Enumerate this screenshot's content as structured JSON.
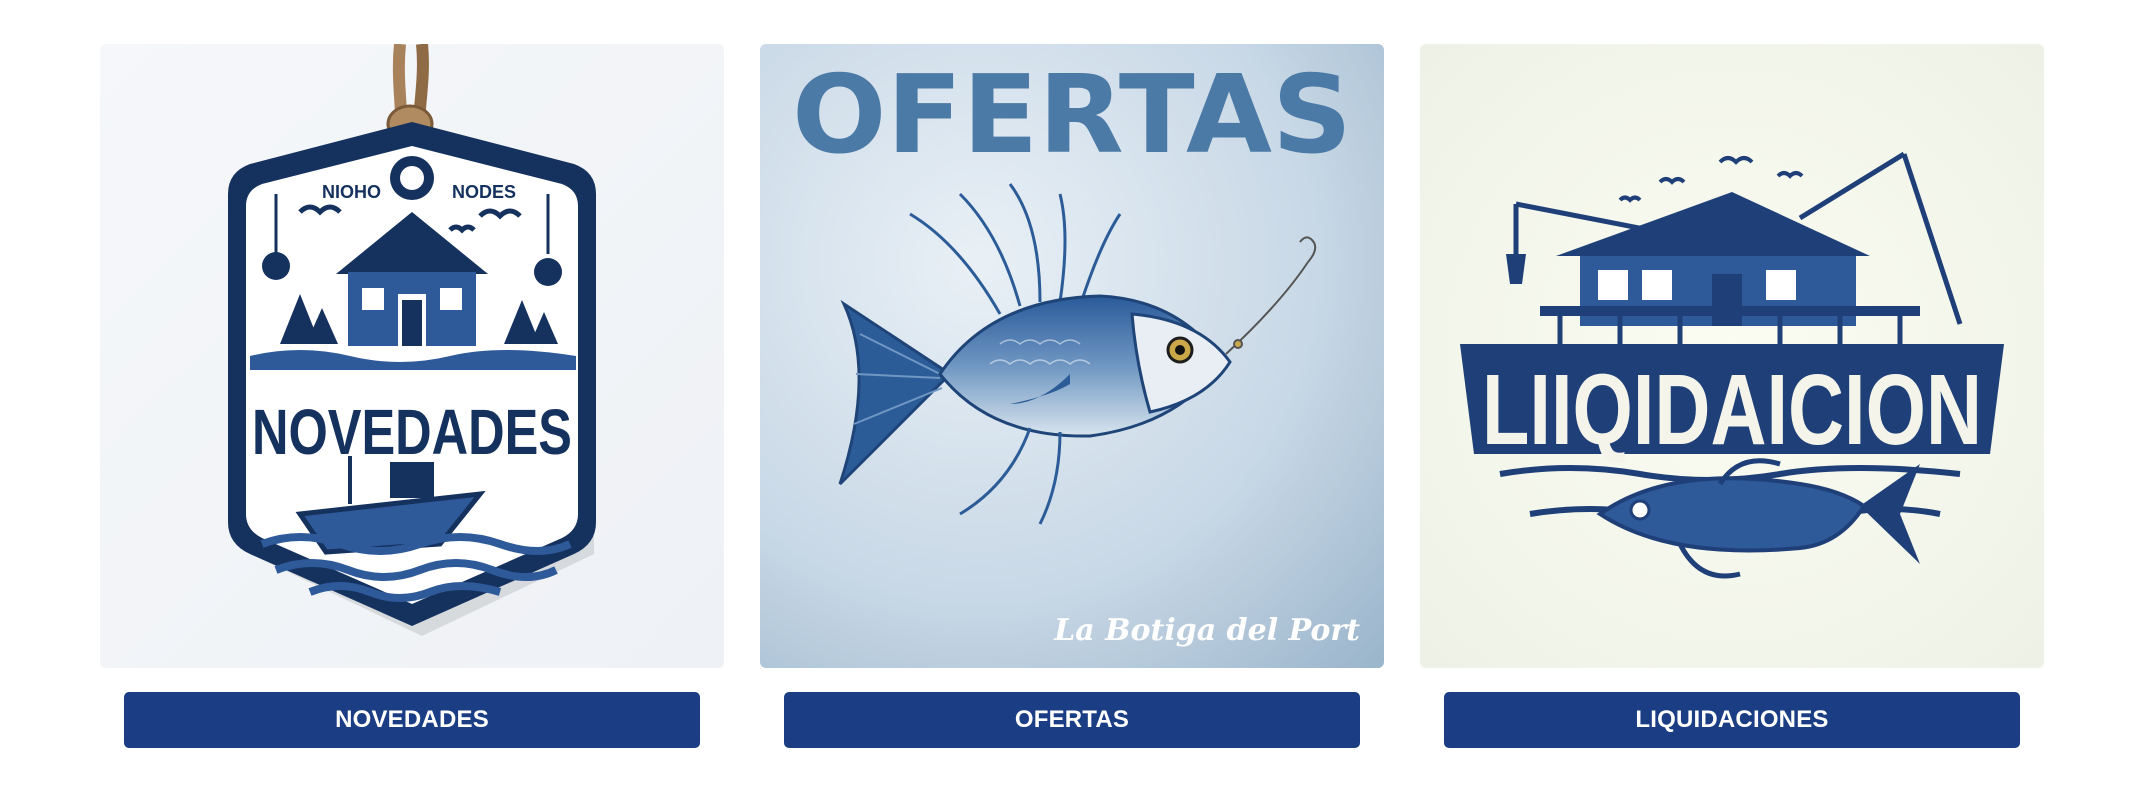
{
  "colors": {
    "button_bg": "#1a3d84",
    "button_text": "#ffffff",
    "navy": "#17305f",
    "steel_blue": "#4c7aa6",
    "light_blue_bg": "#c9d9e6"
  },
  "cards": [
    {
      "button_label": "NOVEDADES",
      "image": {
        "sign_text": "NOVEDADES",
        "top_text_left": "NIOHO",
        "top_text_right": "NODES",
        "icons": [
          "rope-icon",
          "cabin-icon",
          "boat-icon",
          "pine-tree-icon",
          "bird-icon",
          "lantern-icon"
        ]
      }
    },
    {
      "button_label": "OFERTAS",
      "image": {
        "title": "OFERTAS",
        "signature": "La Botiga del Port",
        "icons": [
          "fish-icon",
          "fishing-hook-icon"
        ]
      }
    },
    {
      "button_label": "LIQUIDACIONES",
      "image": {
        "sign_text": "LIIQIDAICION",
        "icons": [
          "stilt-house-icon",
          "fishing-rod-icon",
          "fish-icon",
          "lantern-icon",
          "bird-icon"
        ]
      }
    }
  ]
}
